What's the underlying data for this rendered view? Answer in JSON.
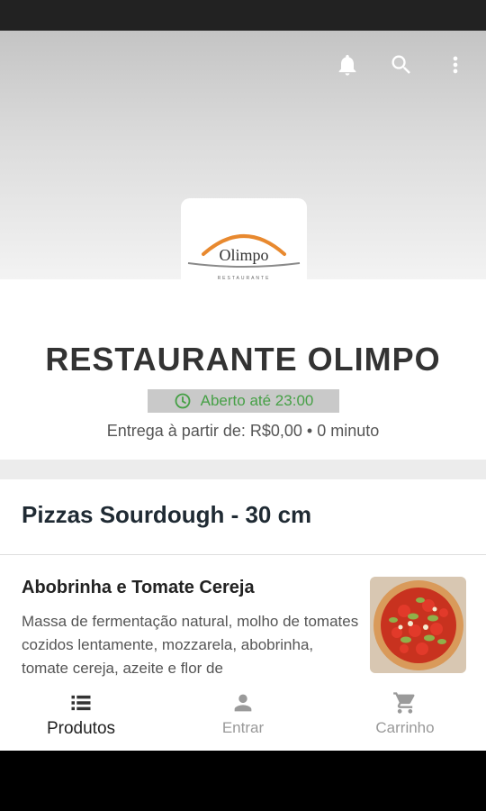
{
  "header": {
    "icons": [
      "bell-icon",
      "search-icon",
      "more-vert-icon"
    ]
  },
  "logo": {
    "wordmark": "Olimpo",
    "tagline": "RESTAURANTE"
  },
  "restaurant": {
    "name": "RESTAURANTE OLIMPO",
    "status": "Aberto até 23:00",
    "status_color": "#46a046",
    "delivery": "Entrega à partir de: R$0,00 • 0 minuto"
  },
  "category": {
    "title": "Pizzas Sourdough - 30 cm"
  },
  "product": {
    "name": "Abobrinha e Tomate Cereja",
    "description": "Massa de fermentação natural, molho de tomates cozidos lentamente, mozzarela, abobrinha, tomate cereja, azeite e flor de",
    "image": "pizza-image"
  },
  "nav": {
    "items": [
      {
        "label": "Produtos",
        "icon": "list-icon",
        "active": true
      },
      {
        "label": "Entrar",
        "icon": "person-icon",
        "active": false
      },
      {
        "label": "Carrinho",
        "icon": "cart-icon",
        "active": false
      }
    ]
  }
}
